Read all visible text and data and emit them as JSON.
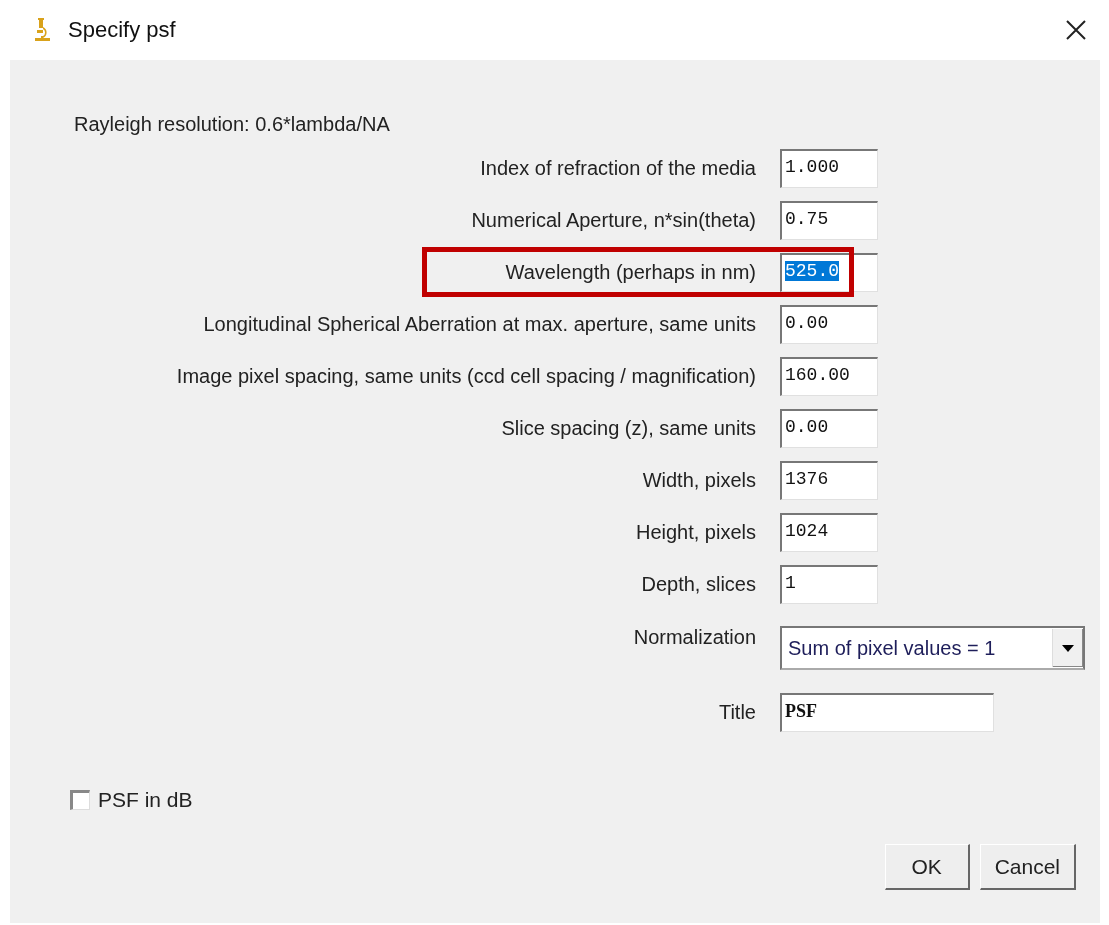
{
  "window": {
    "title": "Specify psf"
  },
  "note": "Rayleigh resolution: 0.6*lambda/NA",
  "fields": [
    {
      "kind": "text",
      "label": "Index of refraction of the media",
      "value": "1.000"
    },
    {
      "kind": "text",
      "label": "Numerical Aperture, n*sin(theta)",
      "value": "0.75"
    },
    {
      "kind": "text",
      "label": "Wavelength (perhaps in nm)",
      "value": "525.0",
      "highlighted": true,
      "text_selected": true
    },
    {
      "kind": "text",
      "label": "Longitudinal Spherical Aberration at max. aperture, same units",
      "value": "0.00"
    },
    {
      "kind": "text",
      "label": "Image pixel spacing, same units (ccd cell spacing / magnification)",
      "value": "160.00"
    },
    {
      "kind": "text",
      "label": "Slice spacing (z), same units",
      "value": "0.00"
    },
    {
      "kind": "text",
      "label": "Width, pixels",
      "value": "1376"
    },
    {
      "kind": "text",
      "label": "Height, pixels",
      "value": "1024"
    },
    {
      "kind": "text",
      "label": "Depth, slices",
      "value": "1"
    },
    {
      "kind": "dropdown",
      "label": "Normalization",
      "value": "Sum of pixel values = 1"
    },
    {
      "kind": "wide_text",
      "label": "Title",
      "value": "PSF"
    }
  ],
  "checkbox": {
    "label": "PSF in dB",
    "checked": false
  },
  "buttons": [
    "OK",
    "Cancel"
  ]
}
